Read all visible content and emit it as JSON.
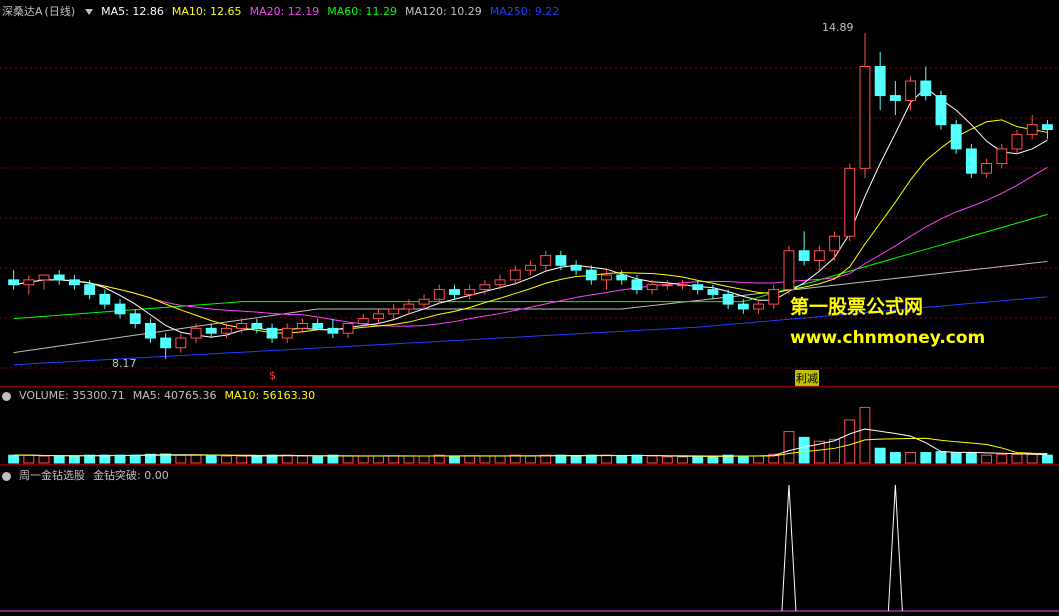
{
  "price_header": {
    "stock": "深桑达A",
    "period": "(日线)",
    "ma5": "MA5: 12.86",
    "ma10": "MA10: 12.65",
    "ma20": "MA20: 12.19",
    "ma60": "MA60: 11.29",
    "ma120": "MA120: 10.29",
    "ma250": "MA250: 9.22"
  },
  "price_labels": {
    "high": "14.89",
    "low": "8.17"
  },
  "markers": {
    "dollar": "$",
    "box": "利减"
  },
  "watermark": {
    "line1": "第一股票公式网",
    "line2": "www.chnmoney.com"
  },
  "volume_header": {
    "volume": "VOLUME: 35300.71",
    "ma5": "MA5: 40765.36",
    "ma10": "MA10: 56163.30"
  },
  "indicator_header": {
    "name": "周一金钻选股",
    "value": "金钻突破: 0.00"
  },
  "colors": {
    "up": "#ff5050",
    "down": "#54ffff",
    "ma5": "#ffffff",
    "ma10": "#ffff00",
    "ma20": "#ff40ff",
    "ma60": "#00ff00",
    "ma120": "#c0c0c0",
    "ma250": "#2040ff",
    "grid": "#8b0000"
  },
  "chart_data": {
    "type": "candlestick",
    "price_range": [
      7.9,
      15.2
    ],
    "candles": [
      [
        9.8,
        10.0,
        9.6,
        9.7
      ],
      [
        9.7,
        9.9,
        9.5,
        9.8
      ],
      [
        9.8,
        9.9,
        9.6,
        9.9
      ],
      [
        9.9,
        10.0,
        9.7,
        9.8
      ],
      [
        9.8,
        9.9,
        9.6,
        9.7
      ],
      [
        9.7,
        9.8,
        9.4,
        9.5
      ],
      [
        9.5,
        9.6,
        9.2,
        9.3
      ],
      [
        9.3,
        9.4,
        9.0,
        9.1
      ],
      [
        9.1,
        9.2,
        8.8,
        8.9
      ],
      [
        8.9,
        9.0,
        8.5,
        8.6
      ],
      [
        8.6,
        8.7,
        8.17,
        8.4
      ],
      [
        8.4,
        8.7,
        8.3,
        8.6
      ],
      [
        8.6,
        8.9,
        8.5,
        8.8
      ],
      [
        8.8,
        8.9,
        8.6,
        8.7
      ],
      [
        8.7,
        8.9,
        8.6,
        8.8
      ],
      [
        8.8,
        9.0,
        8.7,
        8.9
      ],
      [
        8.9,
        9.0,
        8.7,
        8.8
      ],
      [
        8.8,
        8.9,
        8.5,
        8.6
      ],
      [
        8.6,
        8.9,
        8.5,
        8.8
      ],
      [
        8.8,
        9.0,
        8.7,
        8.9
      ],
      [
        8.9,
        9.0,
        8.8,
        8.8
      ],
      [
        8.8,
        9.0,
        8.6,
        8.7
      ],
      [
        8.7,
        8.9,
        8.6,
        8.9
      ],
      [
        8.9,
        9.1,
        8.8,
        9.0
      ],
      [
        9.0,
        9.2,
        8.9,
        9.1
      ],
      [
        9.1,
        9.3,
        9.0,
        9.2
      ],
      [
        9.2,
        9.4,
        9.1,
        9.3
      ],
      [
        9.3,
        9.5,
        9.2,
        9.4
      ],
      [
        9.4,
        9.7,
        9.3,
        9.6
      ],
      [
        9.6,
        9.7,
        9.4,
        9.5
      ],
      [
        9.5,
        9.7,
        9.4,
        9.6
      ],
      [
        9.6,
        9.8,
        9.5,
        9.7
      ],
      [
        9.7,
        9.9,
        9.6,
        9.8
      ],
      [
        9.8,
        10.1,
        9.7,
        10.0
      ],
      [
        10.0,
        10.2,
        9.9,
        10.1
      ],
      [
        10.1,
        10.4,
        10.0,
        10.3
      ],
      [
        10.3,
        10.4,
        10.0,
        10.1
      ],
      [
        10.1,
        10.2,
        9.9,
        10.0
      ],
      [
        10.0,
        10.1,
        9.7,
        9.8
      ],
      [
        9.8,
        10.0,
        9.6,
        9.9
      ],
      [
        9.9,
        10.0,
        9.7,
        9.8
      ],
      [
        9.8,
        9.9,
        9.5,
        9.6
      ],
      [
        9.6,
        9.8,
        9.5,
        9.7
      ],
      [
        9.7,
        9.8,
        9.6,
        9.7
      ],
      [
        9.7,
        9.8,
        9.6,
        9.7
      ],
      [
        9.7,
        9.8,
        9.5,
        9.6
      ],
      [
        9.6,
        9.7,
        9.4,
        9.5
      ],
      [
        9.5,
        9.6,
        9.2,
        9.3
      ],
      [
        9.3,
        9.4,
        9.1,
        9.2
      ],
      [
        9.2,
        9.4,
        9.1,
        9.3
      ],
      [
        9.3,
        9.7,
        9.2,
        9.6
      ],
      [
        9.6,
        10.5,
        9.5,
        10.4
      ],
      [
        10.4,
        10.8,
        10.1,
        10.2
      ],
      [
        10.2,
        10.5,
        10.0,
        10.4
      ],
      [
        10.4,
        10.8,
        10.2,
        10.7
      ],
      [
        10.7,
        12.2,
        10.6,
        12.1
      ],
      [
        12.1,
        14.89,
        11.9,
        14.2
      ],
      [
        14.2,
        14.5,
        13.3,
        13.6
      ],
      [
        13.6,
        13.9,
        13.2,
        13.5
      ],
      [
        13.5,
        14.0,
        13.3,
        13.9
      ],
      [
        13.9,
        14.2,
        13.5,
        13.6
      ],
      [
        13.6,
        13.7,
        12.9,
        13.0
      ],
      [
        13.0,
        13.1,
        12.4,
        12.5
      ],
      [
        12.5,
        12.6,
        11.9,
        12.0
      ],
      [
        12.0,
        12.3,
        11.9,
        12.2
      ],
      [
        12.2,
        12.6,
        12.1,
        12.5
      ],
      [
        12.5,
        12.9,
        12.4,
        12.8
      ],
      [
        12.8,
        13.2,
        12.7,
        13.0
      ],
      [
        13.0,
        13.1,
        12.7,
        12.9
      ]
    ],
    "volume_range": [
      0,
      120000
    ],
    "indicator_signals": [
      0.0,
      1.0
    ]
  }
}
